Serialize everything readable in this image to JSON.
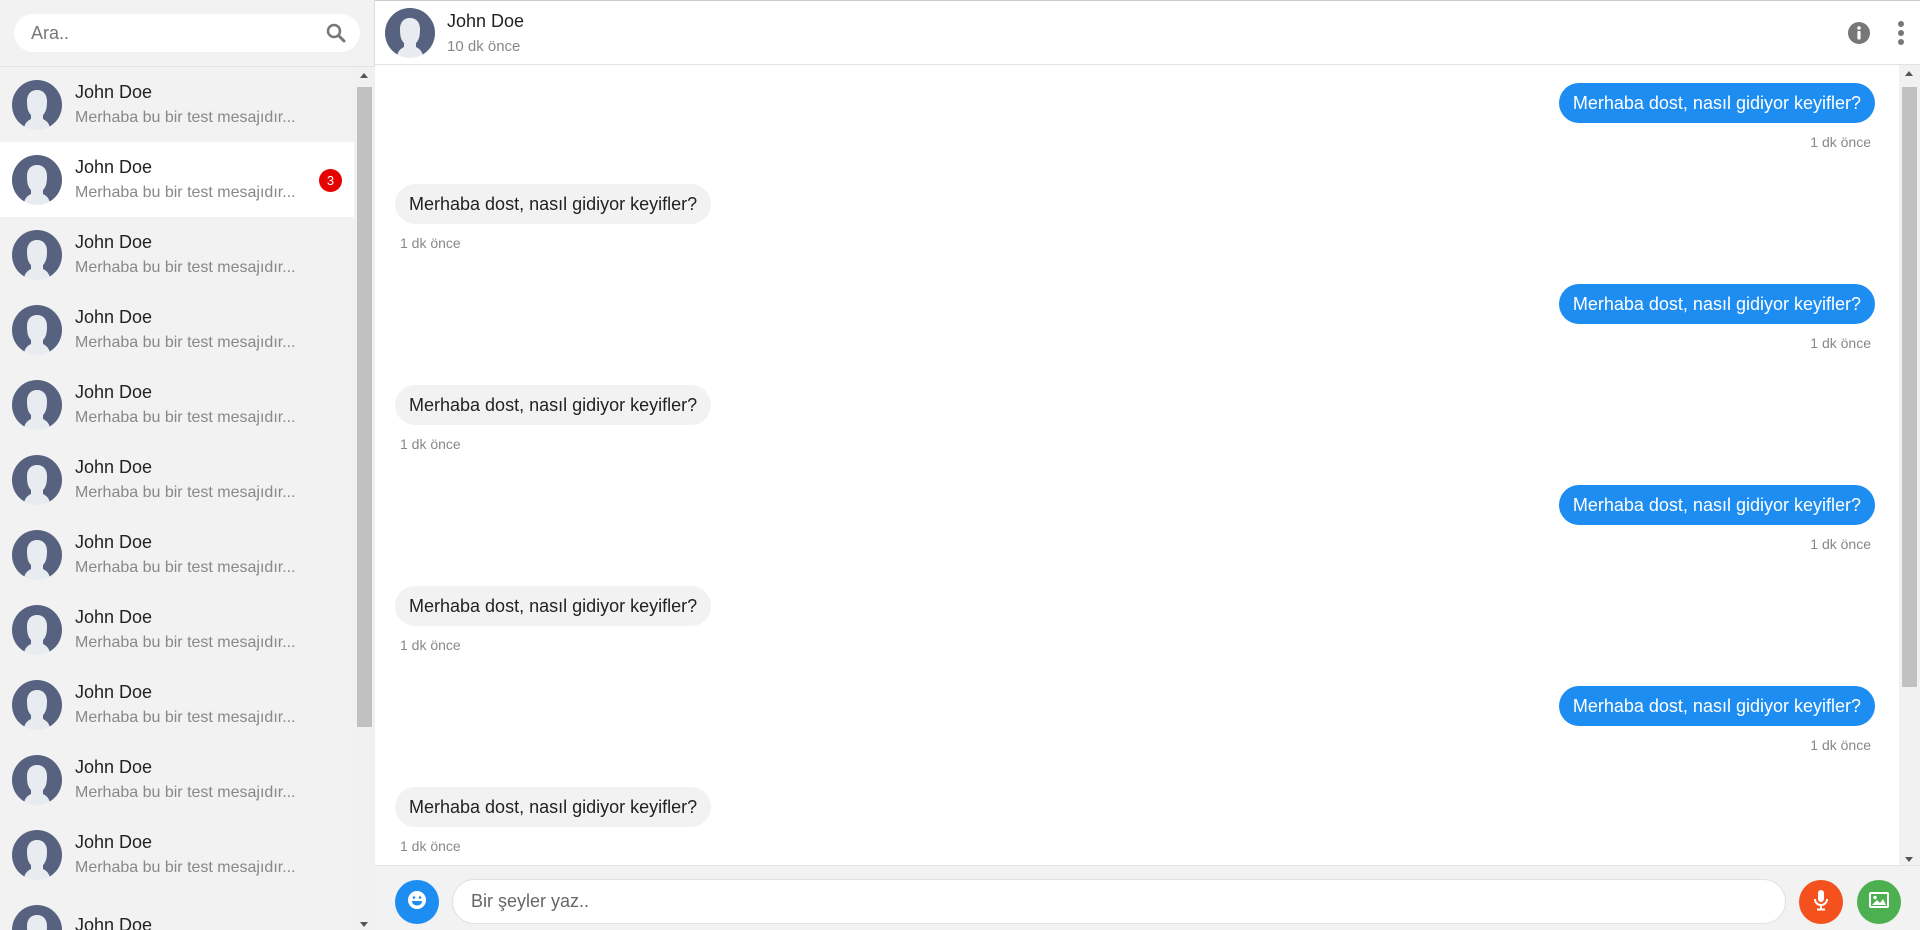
{
  "search": {
    "placeholder": "Ara.."
  },
  "contacts": [
    {
      "name": "John Doe",
      "preview": "Merhaba bu bir test mesajıdır...",
      "badge": ""
    },
    {
      "name": "John Doe",
      "preview": "Merhaba bu bir test mesajıdır...",
      "badge": "3"
    },
    {
      "name": "John Doe",
      "preview": "Merhaba bu bir test mesajıdır...",
      "badge": ""
    },
    {
      "name": "John Doe",
      "preview": "Merhaba bu bir test mesajıdır...",
      "badge": ""
    },
    {
      "name": "John Doe",
      "preview": "Merhaba bu bir test mesajıdır...",
      "badge": ""
    },
    {
      "name": "John Doe",
      "preview": "Merhaba bu bir test mesajıdır...",
      "badge": ""
    },
    {
      "name": "John Doe",
      "preview": "Merhaba bu bir test mesajıdır...",
      "badge": ""
    },
    {
      "name": "John Doe",
      "preview": "Merhaba bu bir test mesajıdır...",
      "badge": ""
    },
    {
      "name": "John Doe",
      "preview": "Merhaba bu bir test mesajıdır...",
      "badge": ""
    },
    {
      "name": "John Doe",
      "preview": "Merhaba bu bir test mesajıdır...",
      "badge": ""
    },
    {
      "name": "John Doe",
      "preview": "Merhaba bu bir test mesajıdır...",
      "badge": ""
    },
    {
      "name": "John Doe",
      "preview": "",
      "badge": ""
    }
  ],
  "active_contact_index": 1,
  "header": {
    "name": "John Doe",
    "status": "10 dk önce"
  },
  "messages": [
    {
      "direction": "out",
      "text": "Merhaba dost, nasıl gidiyor keyifler?",
      "time": "1 dk önce"
    },
    {
      "direction": "in",
      "text": "Merhaba dost, nasıl gidiyor keyifler?",
      "time": "1 dk önce"
    },
    {
      "direction": "out",
      "text": "Merhaba dost, nasıl gidiyor keyifler?",
      "time": "1 dk önce"
    },
    {
      "direction": "in",
      "text": "Merhaba dost, nasıl gidiyor keyifler?",
      "time": "1 dk önce"
    },
    {
      "direction": "out",
      "text": "Merhaba dost, nasıl gidiyor keyifler?",
      "time": "1 dk önce"
    },
    {
      "direction": "in",
      "text": "Merhaba dost, nasıl gidiyor keyifler?",
      "time": "1 dk önce"
    },
    {
      "direction": "out",
      "text": "Merhaba dost, nasıl gidiyor keyifler?",
      "time": "1 dk önce"
    },
    {
      "direction": "in",
      "text": "Merhaba dost, nasıl gidiyor keyifler?",
      "time": "1 dk önce"
    }
  ],
  "composer": {
    "placeholder": "Bir şeyler yaz.."
  },
  "icons": {
    "search": "search-icon",
    "info": "info-icon",
    "more": "more-vertical-icon",
    "emoji": "emoji-icon",
    "mic": "microphone-icon",
    "image": "image-icon",
    "avatar": "user-avatar-icon"
  },
  "colors": {
    "outgoing_bubble": "#1e8df2",
    "incoming_bubble": "#f2f2f2",
    "badge": "#e60000",
    "mic_button": "#f4511e",
    "image_button": "#4caf50",
    "emoji_button": "#1e8df2"
  }
}
